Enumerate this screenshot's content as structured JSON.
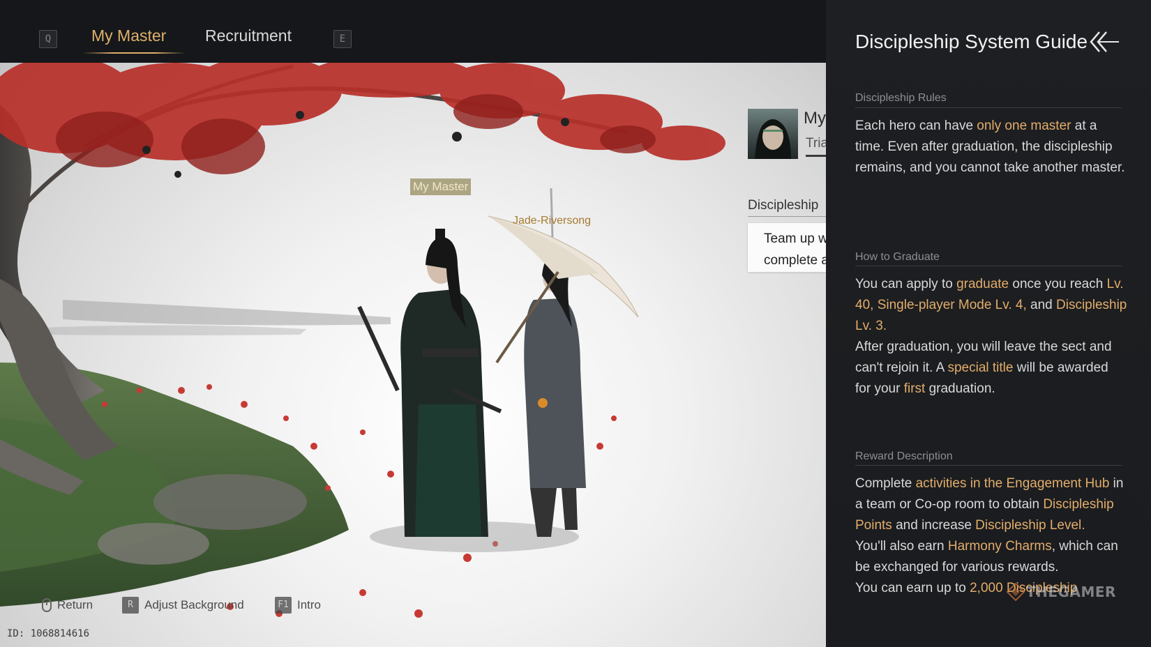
{
  "nav": {
    "prev_key": "Q",
    "next_key": "E",
    "tabs": [
      {
        "label": "My Master",
        "active": true
      },
      {
        "label": "Recruitment",
        "active": false
      }
    ]
  },
  "scene": {
    "master_tag": "My Master",
    "disciple_name": "Jade-Riversong"
  },
  "info_card": {
    "name_partial": "My",
    "subtitle_partial": "Tria",
    "section_label": "Discipleship",
    "task_line_1": "Team up w",
    "task_line_2": "complete a"
  },
  "hints": [
    {
      "key": "",
      "label": "Return",
      "icon": "mouse-icon"
    },
    {
      "key": "R",
      "label": "Adjust Background"
    },
    {
      "key": "F1",
      "label": "Intro"
    }
  ],
  "user_id": "ID: 1068814616",
  "guide": {
    "title": "Discipleship System Guide",
    "collapse_icon": "double-chevron-left-icon",
    "sections": [
      {
        "heading": "Discipleship Rules",
        "paragraphs": [
          [
            {
              "t": "Each hero can have "
            },
            {
              "t": "only one master",
              "hl": true
            },
            {
              "t": " at a time. Even after graduation, the discipleship remains, and you cannot take another master."
            }
          ]
        ]
      },
      {
        "heading": "How to Graduate",
        "paragraphs": [
          [
            {
              "t": "You can apply to "
            },
            {
              "t": "graduate",
              "hl": true
            },
            {
              "t": " once you reach "
            },
            {
              "t": "Lv. 40, Single-player Mode Lv. 4,",
              "hl": true
            },
            {
              "t": " and "
            },
            {
              "t": "Discipleship Lv. 3.",
              "hl": true
            }
          ],
          [
            {
              "t": "After graduation, you will leave the sect and can't rejoin it. A "
            },
            {
              "t": "special title",
              "hl": true
            },
            {
              "t": " will be awarded for your "
            },
            {
              "t": "first",
              "hl": true
            },
            {
              "t": " graduation."
            }
          ]
        ]
      },
      {
        "heading": "Reward Description",
        "paragraphs": [
          [
            {
              "t": "Complete "
            },
            {
              "t": "activities in the Engagement Hub",
              "hl": true
            },
            {
              "t": " in a team or Co-op room to obtain "
            },
            {
              "t": "Discipleship Points",
              "hl": true
            },
            {
              "t": " and increase "
            },
            {
              "t": "Discipleship Level.",
              "hl": true
            }
          ],
          [
            {
              "t": "You'll also earn "
            },
            {
              "t": "Harmony Charms",
              "hl": true
            },
            {
              "t": ", which can be exchanged for various rewards."
            }
          ],
          [
            {
              "t": "You can earn up to "
            },
            {
              "t": "2,000 Discipleship",
              "hl": true
            }
          ]
        ]
      }
    ]
  },
  "watermark": "THEGAMER",
  "colors": {
    "accent": "#e3ad6a",
    "panel_bg": "#1c1e21",
    "topbar_bg": "#15171a"
  }
}
